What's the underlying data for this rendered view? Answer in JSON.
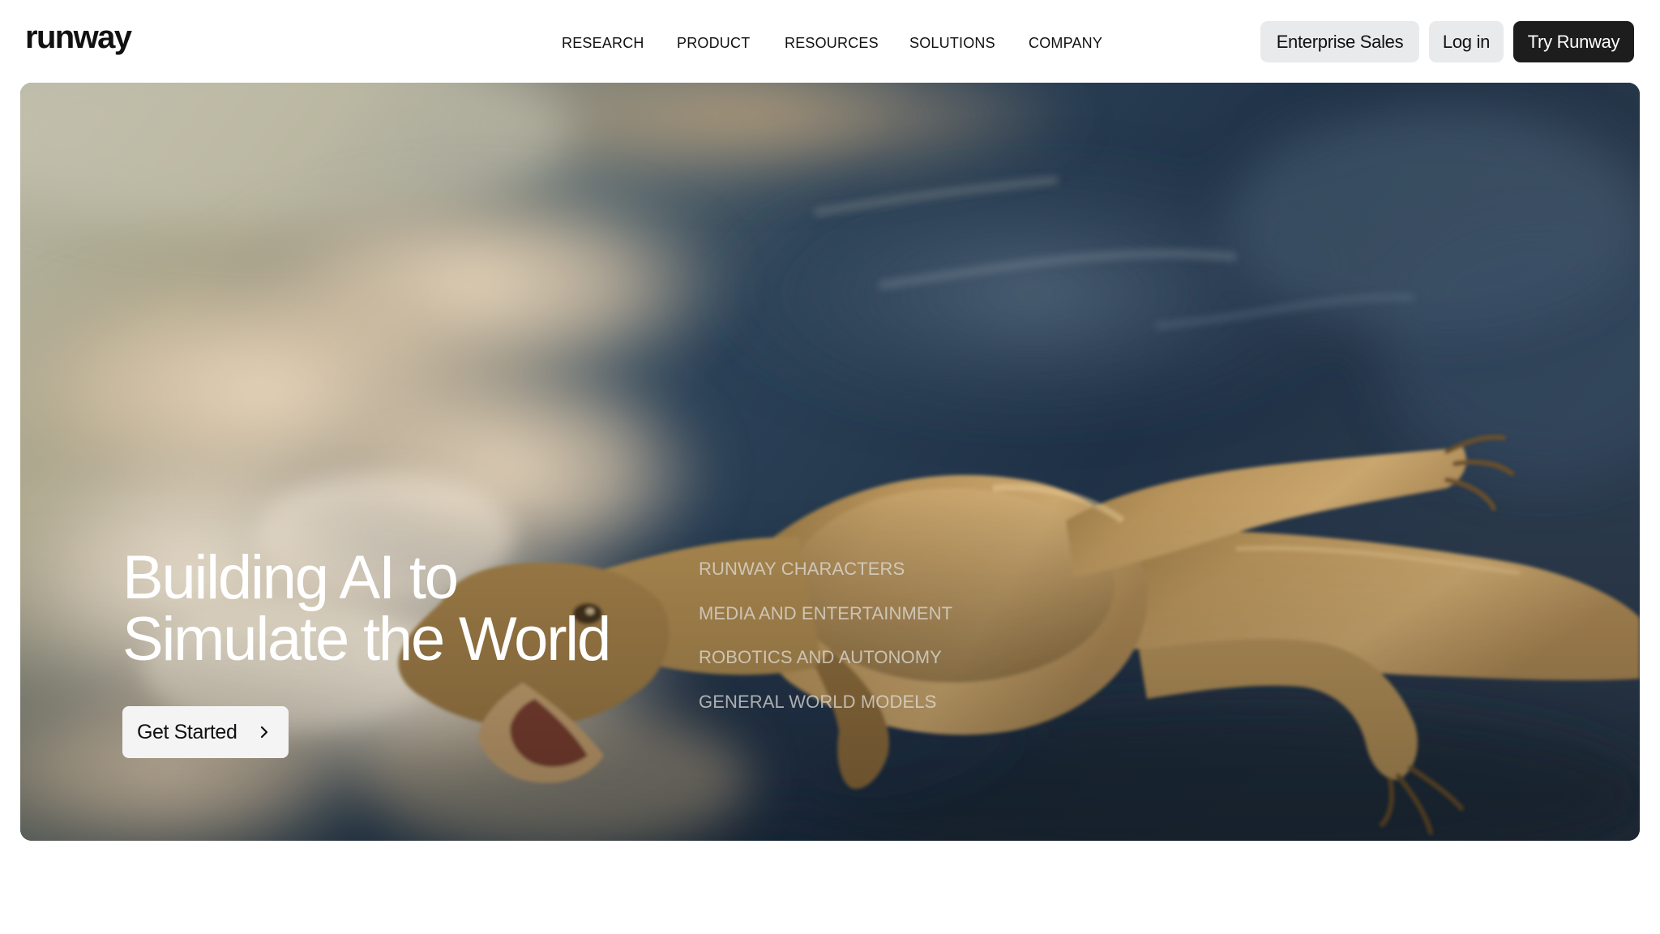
{
  "brand": {
    "logo_text": "runway"
  },
  "nav": {
    "items": [
      {
        "label": "RESEARCH"
      },
      {
        "label": "PRODUCT"
      },
      {
        "label": "RESOURCES"
      },
      {
        "label": "SOLUTIONS"
      },
      {
        "label": "COMPANY"
      }
    ]
  },
  "header_actions": {
    "enterprise_sales": "Enterprise Sales",
    "log_in": "Log in",
    "try_runway": "Try Runway"
  },
  "hero": {
    "title_line1": "Building AI to",
    "title_line2": "Simulate the World",
    "cta_label": "Get Started",
    "cta_icon": "chevron-right-icon",
    "background_image": "flying-dinosaur-in-clouds",
    "features": [
      {
        "label": "RUNWAY CHARACTERS"
      },
      {
        "label": "MEDIA AND ENTERTAINMENT"
      },
      {
        "label": "ROBOTICS AND AUTONOMY"
      },
      {
        "label": "GENERAL WORLD MODELS"
      }
    ]
  },
  "colors": {
    "page_background": "#ffffff",
    "button_light": "#e9eaeb",
    "button_dark": "#1d1d1d",
    "hero_sky": "#1c3147"
  }
}
